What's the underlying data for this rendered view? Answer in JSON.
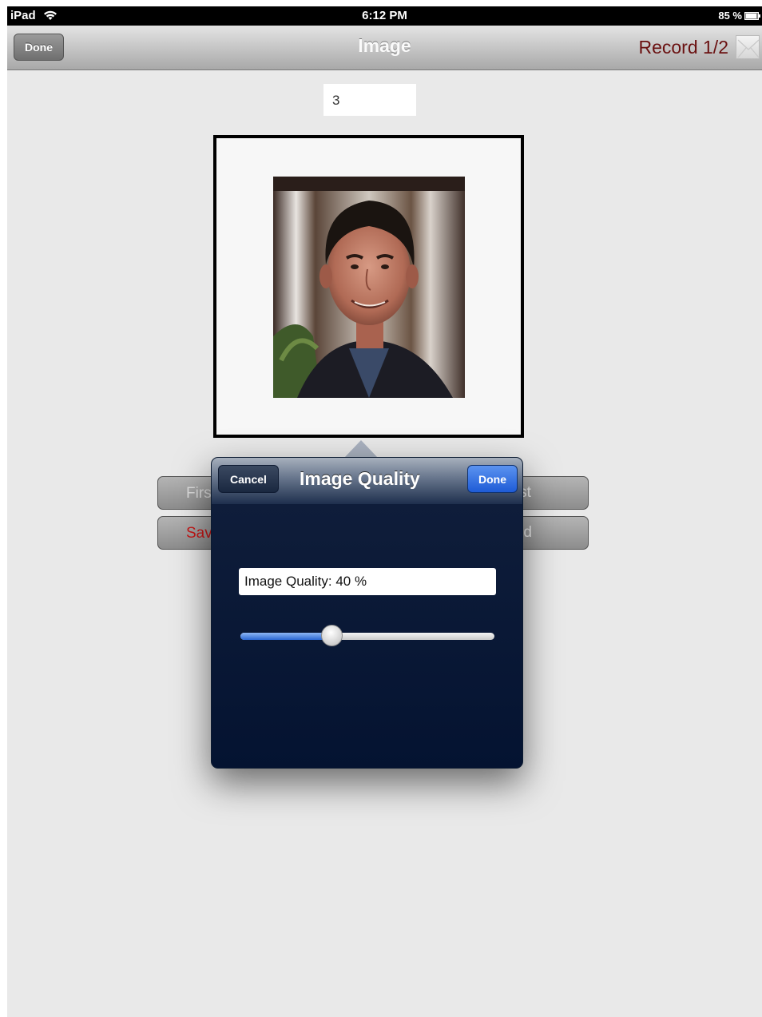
{
  "statusbar": {
    "device": "iPad",
    "time": "6:12 PM",
    "battery": "85 %"
  },
  "navbar": {
    "done_label": "Done",
    "title": "Image",
    "record": "Record 1/2",
    "mail_icon": "mail-icon"
  },
  "content": {
    "number_value": "3"
  },
  "buttons": {
    "first": "First",
    "save": "Save",
    "last": "Last",
    "find": "Find"
  },
  "popover": {
    "title": "Image Quality",
    "cancel_label": "Cancel",
    "done_label": "Done",
    "quality_text": "Image Quality: 40 %",
    "slider_value": 0.36
  },
  "colors": {
    "record_text": "#6a1010",
    "done_blue": "#2a67d2",
    "popover_bg": "#071738",
    "save_red": "#c81818"
  }
}
